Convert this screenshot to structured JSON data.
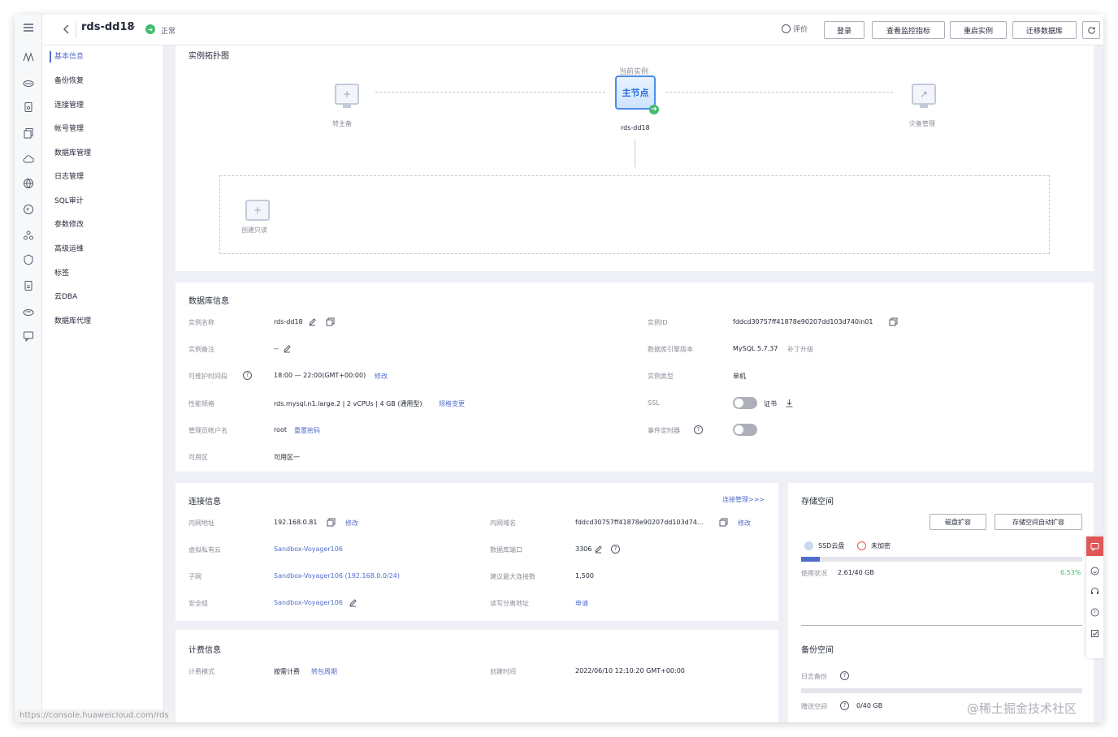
{
  "header": {
    "title": "rds-dd18",
    "status": "正常",
    "rate_label": "评价",
    "buttons": [
      "登录",
      "查看监控指标",
      "重启实例",
      "迁移数据库"
    ]
  },
  "sidebar": {
    "items": [
      {
        "label": "基本信息",
        "active": true
      },
      {
        "label": "备份恢复"
      },
      {
        "label": "连接管理"
      },
      {
        "label": "帐号管理"
      },
      {
        "label": "数据库管理"
      },
      {
        "label": "日志管理"
      },
      {
        "label": "SQL审计"
      },
      {
        "label": "参数修改"
      },
      {
        "label": "高级运维"
      },
      {
        "label": "标签"
      },
      {
        "label": "云DBA"
      },
      {
        "label": "数据库代理"
      }
    ]
  },
  "topology": {
    "title": "实例拓扑图",
    "current_label": "当前实例",
    "main_node": "主节点",
    "main_name": "rds-dd18",
    "to_primary": "转主备",
    "dr_mgmt": "灾备管理",
    "create_readonly": "创建只读"
  },
  "db_info": {
    "title": "数据库信息",
    "name_label": "实例名称",
    "name_value": "rds-dd18",
    "remark_label": "实例备注",
    "remark_value": "--",
    "maint_label": "可维护时间段",
    "maint_value": "18:00 — 22:00(GMT+00:00)",
    "maint_link": "修改",
    "spec_label": "性能规格",
    "spec_value": "rds.mysql.n1.large.2 | 2 vCPUs | 4 GB (通用型)",
    "spec_link": "规格变更",
    "admin_label": "管理员帐户名",
    "admin_value": "root",
    "admin_link": "重置密码",
    "az_label": "可用区",
    "az_value": "可用区一",
    "id_label": "实例ID",
    "id_value": "fddcd30757ff41878e90207dd103d740in01",
    "engine_label": "数据库引擎版本",
    "engine_value": "MySQL 5.7.37",
    "engine_extra": "补丁升级",
    "type_label": "实例类型",
    "type_value": "单机",
    "ssl_label": "SSL",
    "ssl_cert": "证书",
    "event_label": "事件定时器"
  },
  "conn_info": {
    "title": "连接信息",
    "manage_link": "连接管理>>>",
    "ip_label": "内网地址",
    "ip_value": "192.168.0.81",
    "ip_link": "修改",
    "vpc_label": "虚拟私有云",
    "vpc_value": "Sandbox-Voyager106",
    "subnet_label": "子网",
    "subnet_value": "Sandbox-Voyager106 (192.168.0.0/24)",
    "sg_label": "安全组",
    "sg_value": "Sandbox-Voyager106",
    "domain_label": "内网域名",
    "domain_value": "fddcd30757ff41878e90207dd103d74...",
    "domain_link": "修改",
    "port_label": "数据库端口",
    "port_value": "3306",
    "maxconn_label": "建议最大连接数",
    "maxconn_value": "1,500",
    "rw_label": "读写分离地址",
    "rw_link": "申请"
  },
  "billing": {
    "title": "计费信息",
    "mode_label": "计费模式",
    "mode_value": "按需计费",
    "mode_link": "转包周期",
    "created_label": "创建时间",
    "created_value": "2022/06/10 12:10:20 GMT+00:00"
  },
  "storage": {
    "title": "存储空间",
    "btn_expand": "磁盘扩容",
    "btn_auto": "存储空间自动扩容",
    "disk_type": "SSD云盘",
    "encrypt": "未加密",
    "usage_label": "使用状况",
    "usage_value": "2.61/40 GB",
    "usage_percent": "6.53%",
    "usage_fraction": 0.0653
  },
  "backup": {
    "title": "备份空间",
    "log_label": "日志备份",
    "free_label": "赠送空间",
    "free_value": "0/40 GB"
  },
  "footer": {
    "url": "https://console.huaweicloud.com/rds",
    "watermark": "@稀土掘金技术社区"
  }
}
